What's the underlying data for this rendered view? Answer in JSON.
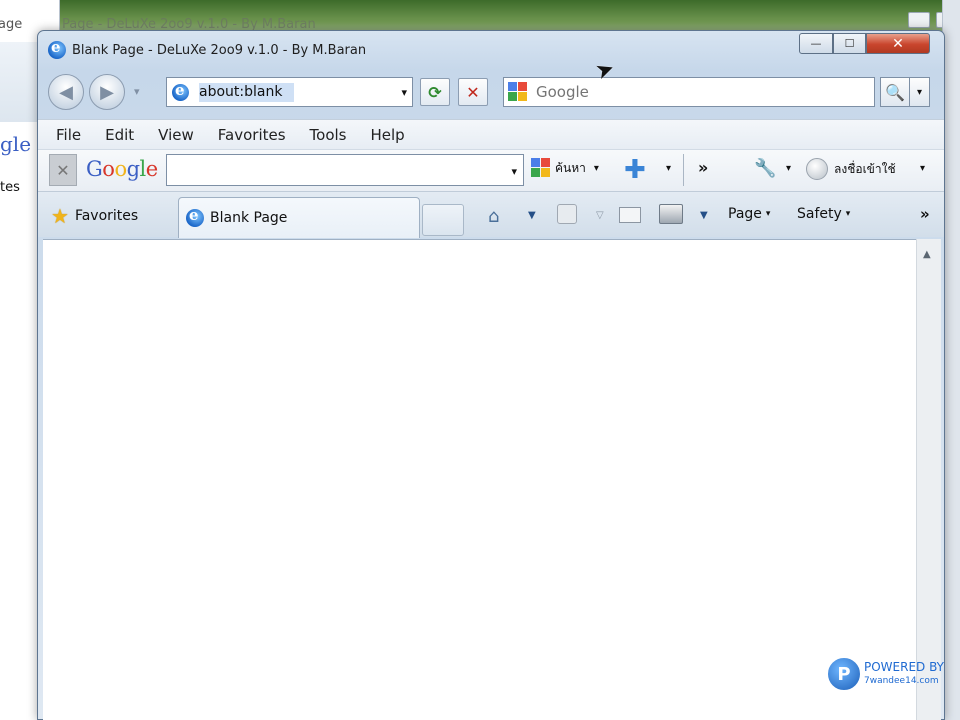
{
  "window": {
    "title": "Blank Page - DeLuXe 2oo9 v.1.0 - By M.Baran",
    "bg_title": "Page - DeLuXe 2oo9 v.1.0 - By M.Baran",
    "controls": {
      "minimize": "—",
      "maximize": "☐",
      "close": "✕"
    }
  },
  "nav": {
    "back_icon": "◀",
    "forward_icon": "▶",
    "address_value": "about:blank",
    "refresh_icon": "⟳",
    "stop_icon": "✕",
    "search_placeholder": "Google",
    "search_go_icon": "🔍",
    "dropdown": "▾"
  },
  "menu": {
    "items": [
      "File",
      "Edit",
      "View",
      "Favorites",
      "Tools",
      "Help"
    ]
  },
  "google_toolbar": {
    "close": "✕",
    "logo": "Google",
    "search_label": "ค้นหา",
    "plus": "✚",
    "more": "»",
    "wrench": "🔧",
    "signin": "ลงชื่อเข้าใช้"
  },
  "tabs": {
    "favorites_label": "Favorites",
    "active_tab_label": "Blank Page",
    "page_label": "Page",
    "safety_label": "Safety",
    "home_icon": "⌂",
    "more": "»",
    "dropdown": "▾"
  },
  "background_window": {
    "google_fragment": "gle",
    "tes_fragment": "tes"
  },
  "watermark": {
    "line1": "POWERED BY",
    "line2": "7wandee14.com"
  },
  "colors": {
    "close_button": "#c9452d",
    "google_blue": "#3b5fc4",
    "refresh_green": "#2f8a2f",
    "stop_red": "#c0281c"
  }
}
